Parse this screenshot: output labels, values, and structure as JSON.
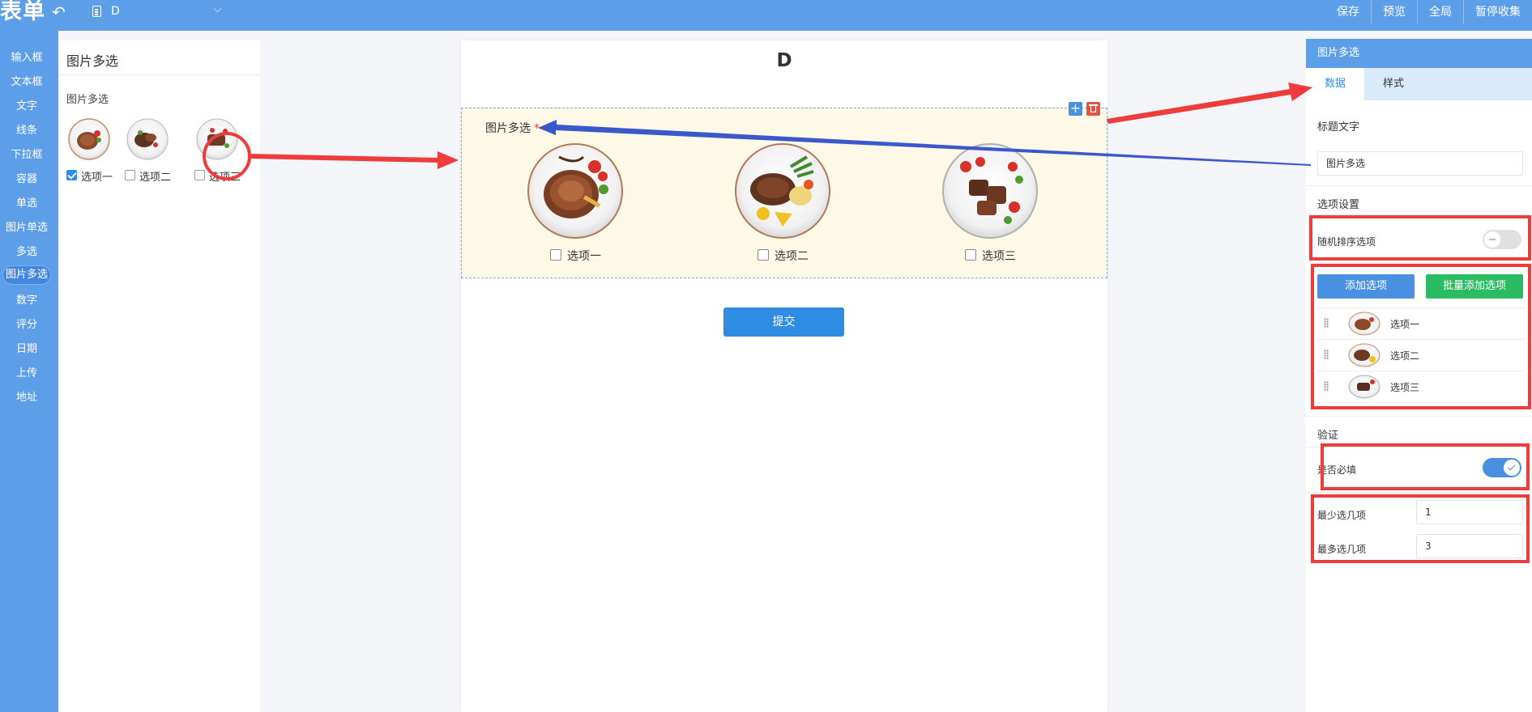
{
  "app": {
    "logo": "表单",
    "doc_name": "D"
  },
  "top_actions": [
    "保存",
    "预览",
    "全局",
    "暂停收集"
  ],
  "nav": [
    "输入框",
    "文本框",
    "文字",
    "线条",
    "下拉框",
    "容器",
    "单选",
    "图片单选",
    "多选",
    "图片多选",
    "数字",
    "评分",
    "日期",
    "上传",
    "地址"
  ],
  "nav_active": "图片多选",
  "component_panel": {
    "title": "图片多选",
    "subtitle": "图片多选",
    "options": [
      {
        "label": "选项一",
        "checked": true
      },
      {
        "label": "选项二",
        "checked": false
      },
      {
        "label": "选项三",
        "checked": false
      }
    ]
  },
  "form": {
    "title": "D",
    "field_label": "图片多选",
    "required_mark": "*",
    "options": [
      "选项一",
      "选项二",
      "选项三"
    ],
    "submit_label": "提交"
  },
  "props": {
    "header": "图片多选",
    "tabs": [
      "数据",
      "样式"
    ],
    "active_tab": "数据",
    "title_text_label": "标题文字",
    "title_text_value": "图片多选",
    "option_settings_label": "选项设置",
    "random_order_label": "随机排序选项",
    "random_order_on": false,
    "add_option_label": "添加选项",
    "batch_add_label": "批量添加选项",
    "options": [
      "选项一",
      "选项二",
      "选项三"
    ],
    "validation_label": "验证",
    "required_label": "是否必填",
    "required_on": true,
    "min_label": "最少选几项",
    "min_value": "1",
    "max_label": "最多选几项",
    "max_value": "3"
  },
  "colors": {
    "primary": "#5d9ee9",
    "button_blue": "#4a90e2",
    "button_green": "#2bbb63",
    "annotation_red": "#ee3b3b",
    "annotation_blue": "#3a58cc",
    "field_bg": "#fef8e6"
  },
  "icons": [
    "undo-icon",
    "document-icon",
    "chevron-down-icon",
    "plus-icon",
    "trash-icon",
    "drag-handle-icon",
    "check-icon"
  ]
}
